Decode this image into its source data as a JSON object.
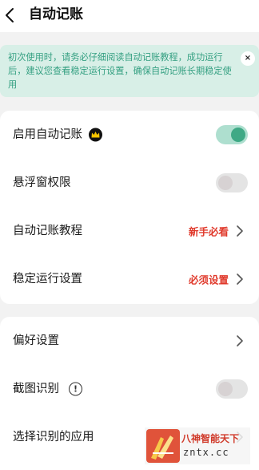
{
  "header": {
    "title": "自动记账",
    "back_icon": "chevron-left-icon"
  },
  "notice": {
    "text": "初次使用时，请务必仔细阅读自动记账教程，成功运行后，建议您查看稳定运行设置，确保自动记账长期稳定使用",
    "close_label": "×",
    "text_color": "#35a082",
    "background": "#d8efe7"
  },
  "settings_group_1": {
    "rows": [
      {
        "label": "启用自动记账",
        "badge_icon": "crown-icon",
        "toggle": true
      },
      {
        "label": "悬浮窗权限",
        "toggle": false
      },
      {
        "label": "自动记账教程",
        "value": "新手必看",
        "chevron": true
      },
      {
        "label": "稳定运行设置",
        "value": "必须设置",
        "chevron": true
      }
    ]
  },
  "settings_group_2": {
    "rows": [
      {
        "label": "偏好设置",
        "chevron": true
      },
      {
        "label": "截图识别",
        "info_icon": "!",
        "toggle": false
      },
      {
        "label": "选择识别的应用",
        "chevron": true
      }
    ]
  },
  "watermark": {
    "title": "八神智能天下",
    "url": "zntx.cc"
  },
  "colors": {
    "accent_green": "#3fa985",
    "warning_red": "#e0392b",
    "page_background": "#f2f2f2"
  }
}
